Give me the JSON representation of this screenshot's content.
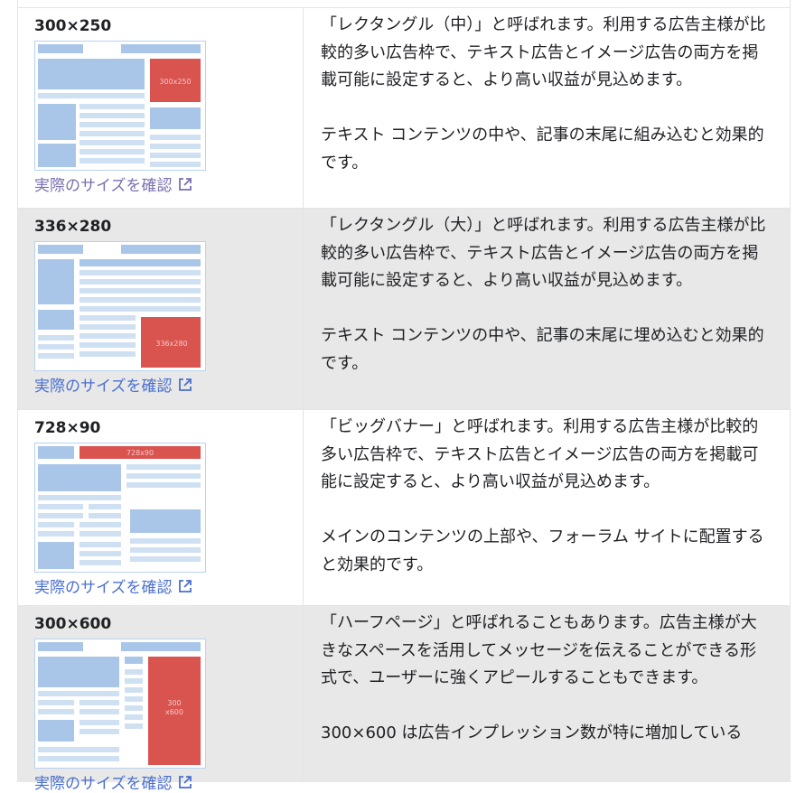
{
  "colors": {
    "link_visited": "#7b6fb0",
    "link": "#4a6fce",
    "row_alt_bg": "#e8e8e8",
    "ad_red": "#d9534f",
    "layout_blue": "#a9c6e8"
  },
  "rows": [
    {
      "size": "300×250",
      "ad_label": "300x250",
      "link_label": "実際のサイズを確認",
      "link_icon": "external-link-icon",
      "desc1": "「レクタングル（中）」と呼ばれます。利用する広告主様が比較的多い広告枠で、テキスト広告とイメージ広告の両方を掲載可能に設定すると、より高い収益が見込めます。",
      "desc2": "テキスト コンテンツの中や、記事の末尾に組み込むと効果的です。"
    },
    {
      "size": "336×280",
      "ad_label": "336x280",
      "link_label": "実際のサイズを確認",
      "link_icon": "external-link-icon",
      "desc1": "「レクタングル（大）」と呼ばれます。利用する広告主様が比較的多い広告枠で、テキスト広告とイメージ広告の両方を掲載可能に設定すると、より高い収益が見込めます。",
      "desc2": "テキスト コンテンツの中や、記事の末尾に埋め込むと効果的です。"
    },
    {
      "size": "728×90",
      "ad_label": "728x90",
      "link_label": "実際のサイズを確認",
      "link_icon": "external-link-icon",
      "desc1": "「ビッグバナー」と呼ばれます。利用する広告主様が比較的多い広告枠で、テキスト広告とイメージ広告の両方を掲載可能に設定すると、より高い収益が見込めます。",
      "desc2": "メインのコンテンツの上部や、フォーラム サイトに配置すると効果的です。"
    },
    {
      "size": "300×600",
      "ad_label_line1": "300",
      "ad_label_line2": "x600",
      "link_label": "実際のサイズを確認",
      "link_icon": "external-link-icon",
      "desc1": "「ハーフページ」と呼ばれることもあります。広告主様が大きなスペースを活用してメッセージを伝えることができる形式で、ユーザーに強くアピールすることもできます。",
      "desc2": "300×600 は広告インプレッション数が特に増加している"
    }
  ]
}
